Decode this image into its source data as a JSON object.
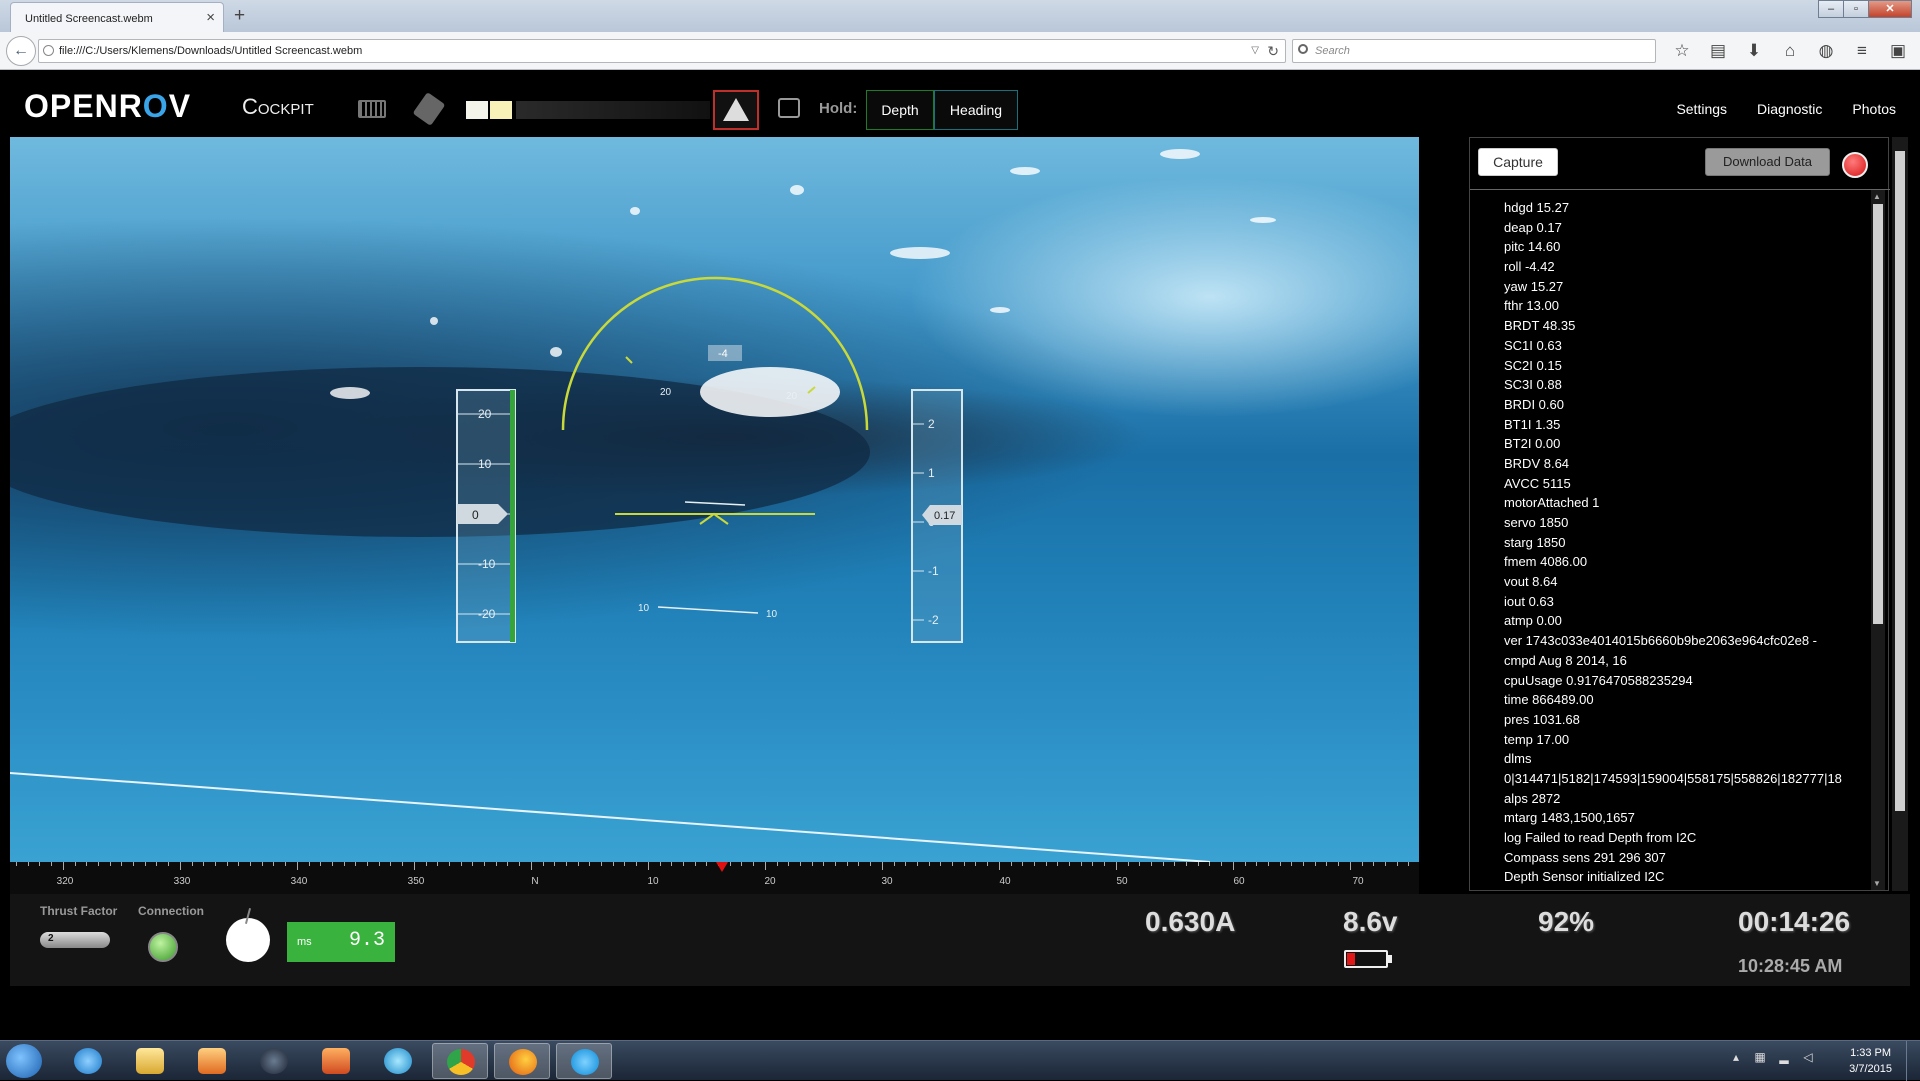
{
  "browser": {
    "tab_title": "Untitled Screencast.webm",
    "tab_close": "×",
    "new_tab": "+",
    "url": "file:///C:/Users/Klemens/Downloads/Untitled Screencast.webm",
    "search_placeholder": "Search"
  },
  "header": {
    "logo_left": "OPEN",
    "logo_r": "R",
    "logo_o": "O",
    "logo_v": "V",
    "cockpit": "Cockpit",
    "hold_label": "Hold:",
    "hold_depth": "Depth",
    "hold_heading": "Heading",
    "menu": [
      "Settings",
      "Diagnostic",
      "Photos"
    ]
  },
  "hud": {
    "depth_scale": [
      "20",
      "10",
      "0",
      "-10",
      "-20"
    ],
    "depth_value": "0",
    "right_scale": [
      "2",
      "1",
      "0",
      "-1",
      "-2"
    ],
    "right_value": "0.17",
    "roll_value": "-4",
    "pitch_labels": [
      "20",
      "20",
      "10",
      "10"
    ],
    "heading_tape": [
      "320",
      "330",
      "340",
      "350",
      "N",
      "10",
      "20",
      "30",
      "40",
      "50",
      "60",
      "70"
    ]
  },
  "telemetry": {
    "capture": "Capture",
    "download": "Download Data",
    "items": [
      "hdgd 15.27",
      "deap 0.17",
      "pitc 14.60",
      "roll -4.42",
      "yaw 15.27",
      "fthr 13.00",
      "BRDT 48.35",
      "SC1I 0.63",
      "SC2I 0.15",
      "SC3I 0.88",
      "BRDI 0.60",
      "BT1I 1.35",
      "BT2I 0.00",
      "BRDV 8.64",
      "AVCC 5115",
      "motorAttached 1",
      "servo 1850",
      "starg 1850",
      "fmem 4086.00",
      "vout 8.64",
      "iout 0.63",
      "atmp 0.00",
      "ver 1743c033e4014015b6660b9be2063e964cfc02e8 -",
      "cmpd Aug 8 2014, 16",
      "cpuUsage 0.9176470588235294",
      "time 866489.00",
      "pres 1031.68",
      "temp 17.00",
      "dlms",
      "0|314471|5182|174593|159004|558175|558826|182777|18",
      "alps 2872",
      "mtarg 1483,1500,1657",
      "log Failed to read Depth from I2C",
      "Compass sens 291 296 307",
      "Depth Sensor initialized I2C"
    ]
  },
  "status": {
    "thrust_label": "Thrust Factor",
    "thrust_value": "2",
    "connection_label": "Connection",
    "latency_unit": "ms",
    "latency_value": "9.3",
    "current": "0.630A",
    "voltage": "8.6v",
    "percent": "92%",
    "battery_level": 0.2,
    "elapsed": "00:14:26",
    "clock": "10:28:45 AM"
  },
  "taskbar": {
    "time": "1:33 PM",
    "date": "3/7/2015"
  },
  "colors": {
    "hud_green": "#c9d93a",
    "depth_bar": "#35a43a",
    "accent_blue": "#3aa4e8",
    "laser_border": "#c0302a",
    "latency_green": "#39b33e",
    "record_red": "#d81515"
  }
}
